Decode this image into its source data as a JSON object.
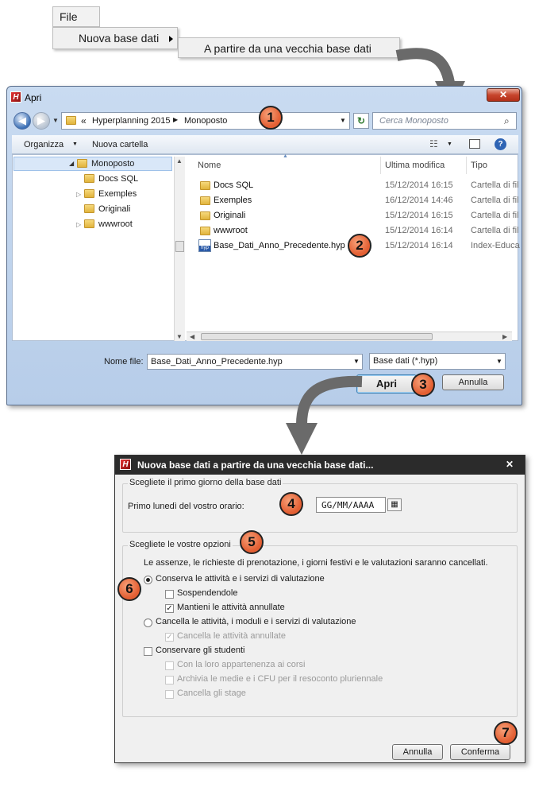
{
  "menu": {
    "file": "File",
    "new_db": "Nuova base dati",
    "from_old": "A partire da una vecchia base dati"
  },
  "open_dialog": {
    "title": "Apri",
    "close": "✕",
    "address": {
      "chevrons": "«",
      "segment1": "Hyperplanning 2015",
      "segment2": "Monoposto"
    },
    "search_placeholder": "Cerca Monoposto",
    "toolbar": {
      "organize": "Organizza",
      "new_folder": "Nuova cartella"
    },
    "tree": [
      "Monoposto",
      "Docs SQL",
      "Exemples",
      "Originali",
      "wwwroot"
    ],
    "columns": {
      "name": "Nome",
      "modified": "Ultima modifica",
      "type": "Tipo"
    },
    "files": [
      {
        "name": "Docs SQL",
        "date": "15/12/2014 16:15",
        "type": "Cartella di fil"
      },
      {
        "name": "Exemples",
        "date": "16/12/2014 14:46",
        "type": "Cartella di fil"
      },
      {
        "name": "Originali",
        "date": "15/12/2014 16:15",
        "type": "Cartella di fil"
      },
      {
        "name": "wwwroot",
        "date": "15/12/2014 16:14",
        "type": "Cartella di fil"
      },
      {
        "name": "Base_Dati_Anno_Precedente.hyp",
        "date": "15/12/2014 16:14",
        "type": "Index-Educa",
        "icon_text": "hyp"
      }
    ],
    "filename_label": "Nome file:",
    "filename_value": "Base_Dati_Anno_Precedente.hyp",
    "filetype": "Base dati (*.hyp)",
    "open_btn": "Apri",
    "cancel_btn": "Annulla"
  },
  "new_db_dialog": {
    "title": "Nuova base dati a partire da una vecchia base dati...",
    "close": "✕",
    "group1_legend": "Scegliete il primo giorno della base dati",
    "first_monday_label": "Primo lunedì del vostro orario:",
    "date_value": "GG/MM/AAAA",
    "group2_legend": "Scegliete le vostre opzioni",
    "info": "Le assenze, le richieste di prenotazione, i giorni festivi e le valutazioni saranno cancellati.",
    "opt_keep": "Conserva le attività e i servizi di valutazione",
    "opt_suspend": "Sospendendole",
    "opt_keep_cancelled": "Mantieni le attività annullate",
    "opt_delete": "Cancella le attività, i moduli e i servizi di valutazione",
    "opt_delete_cancelled": "Cancella le attività annullate",
    "opt_students": "Conservare gli studenti",
    "opt_course": "Con la loro appartenenza ai corsi",
    "opt_archive": "Archivia le medie e i CFU per il resoconto pluriennale",
    "opt_stage": "Cancella gli stage",
    "cancel_btn": "Annulla",
    "confirm_btn": "Conferma"
  },
  "badges": [
    "1",
    "2",
    "3",
    "4",
    "5",
    "6",
    "7"
  ]
}
